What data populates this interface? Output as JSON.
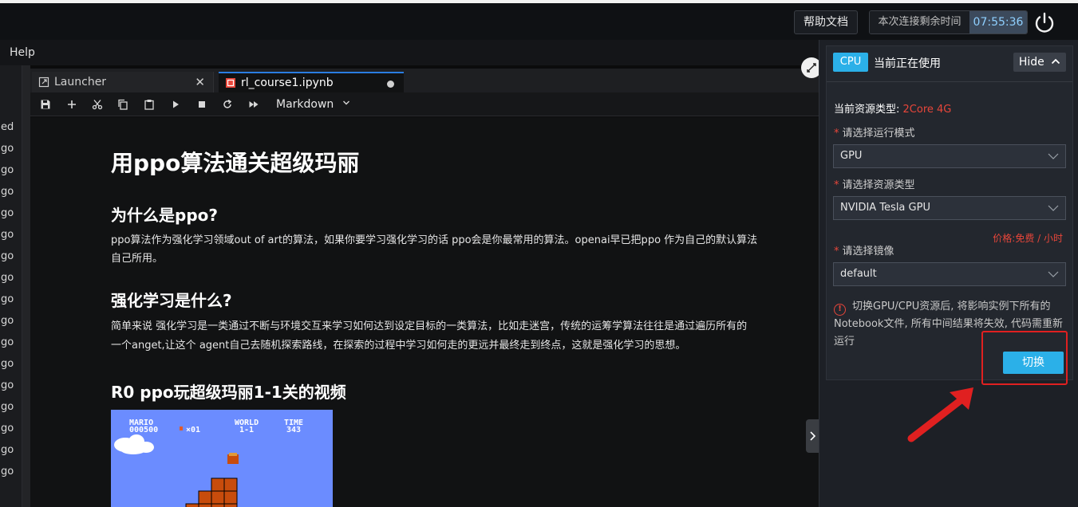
{
  "topbar": {
    "help_docs": "帮助文档",
    "time_left_label": "本次连接剩余时间",
    "time_left_value": "07:55:36"
  },
  "menubar": {
    "help": "Help"
  },
  "left_strip": [
    "ed",
    "go",
    "go",
    "go",
    "go",
    "go",
    "go",
    "go",
    "go",
    "go",
    "go",
    "go",
    "go",
    "go",
    "go",
    "go",
    "go",
    "go"
  ],
  "tabs": {
    "launcher": "Launcher",
    "notebook": "rl_course1.ipynb"
  },
  "toolbar": {
    "cell_type": "Markdown"
  },
  "notebook": {
    "title": "用ppo算法通关超级玛丽",
    "h_why": "为什么是ppo?",
    "p_why_1": "ppo算法作为强化学习领域out of art的算法，如果你要学习强化学习的话 ppo会是你最常用的算法。openai早已把ppo 作为自己的默认算法",
    "p_why_2": "自己所用。",
    "h_what": "强化学习是什么?",
    "p_what_1": "简单来说 强化学习是一类通过不断与环境交互来学习如何达到设定目标的一类算法，比如走迷宫，传统的运筹学算法往往是通过遍历所有的",
    "p_what_2": "一个anget,让这个 agent自己去随机探索路线，在探索的过程中学习如何走的更远并最终走到终点，这就是强化学习的思想。",
    "h_video": "R0 ppo玩超级玛丽1-1关的视频",
    "mario_hud": {
      "mario_label": "MARIO",
      "score": "000500",
      "coins": "×01",
      "world_label": "WORLD",
      "world": "1-1",
      "time_label": "TIME",
      "time": "343"
    }
  },
  "panel": {
    "badge": "CPU",
    "in_use": "当前正在使用",
    "hide": "Hide",
    "res_type_label": "当前资源类型:",
    "res_type_value": "2Core 4G",
    "mode_label": "请选择运行模式",
    "mode_value": "GPU",
    "resource_label": "请选择资源类型",
    "resource_value": "NVIDIA Tesla GPU",
    "price": "价格:免费 / 小时",
    "image_label": "请选择镜像",
    "image_value": "default",
    "warning": "切换GPU/CPU资源后, 将影响实例下所有的Notebook文件, 所有中间结果将失效, 代码需重新运行",
    "switch": "切换"
  },
  "colors": {
    "accent": "#2bb0e8",
    "danger": "#e8463a",
    "tab_active": "#2a7de1"
  }
}
